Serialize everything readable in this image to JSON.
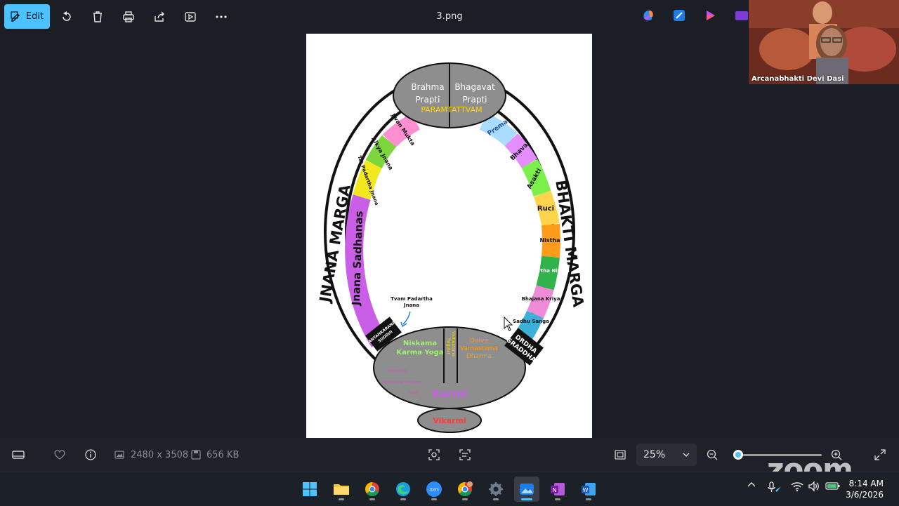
{
  "toolbar": {
    "edit_label": "Edit",
    "file_title": "3.png",
    "icons": [
      "rotate-icon",
      "delete-icon",
      "print-icon",
      "share-icon",
      "slideshow-icon",
      "more-icon"
    ],
    "right_icons": [
      "copilot-icon",
      "designer-icon",
      "clipchamp-icon",
      "photos-icon"
    ]
  },
  "video": {
    "participant_name": "Arcanabhakti Devi Dasi"
  },
  "diagram": {
    "top": {
      "left": "Brahma\nPrapti",
      "right": "Bhagavat\nPrapti",
      "title": "PARAMTATTVAM"
    },
    "left_arc_title": "JNANA MARGA",
    "right_arc_title": "BHAKTI MARGA",
    "left_segments": [
      "Jivan Mukta",
      "Aikya Jnana",
      "Tat Padartha Jnana",
      "Jnana Sadhanas"
    ],
    "right_segments": [
      "Prema",
      "Bhava",
      "Asakti",
      "Ruci",
      "Nistha",
      "Anartha Nivrtti",
      "Bhajana Kriya",
      "Sadhu Sanga"
    ],
    "left_badge": "ANTAHKARANA SUDDHI",
    "right_badge": "DRDHA SRADDHA",
    "tvam_label": "Tvam Padartha Jnana",
    "bottom_left": "Niskama Karma Yoga",
    "bottom_center_a": "Regular",
    "bottom_center_b": "Varnasrama",
    "bottom_right": "Daiva Varnasrama Dharma",
    "bottom_small": [
      "Ethical Life",
      "Sociological Worshiper",
      "Guild"
    ],
    "karmi": "Karmi",
    "vikarmi": "Vikarmi",
    "colors": {
      "jnana_purple": "#c85fe6",
      "bhakti_orange": "#ff9c1a",
      "gray": "#8e8e8e"
    }
  },
  "statusbar": {
    "dimensions": "2480 x 3508",
    "file_size": "656 KB",
    "zoom_value": "25%",
    "zoom_fraction": 0.05
  },
  "taskbar": {
    "apps": [
      "start-icon",
      "file-explorer-icon",
      "chrome-icon",
      "edge-icon",
      "zoom-app-icon",
      "chrome-profile-icon",
      "settings-icon",
      "photos-app-icon",
      "onenote-icon",
      "word-icon"
    ],
    "time": "8:14 AM",
    "date": "3/6/2026"
  },
  "zoom_logo": "zoom"
}
